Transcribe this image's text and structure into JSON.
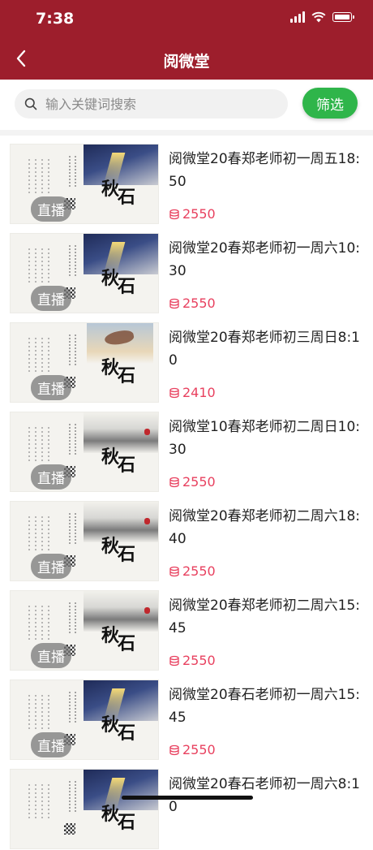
{
  "status_bar": {
    "time": "7:38"
  },
  "nav": {
    "title": "阅微堂"
  },
  "search": {
    "placeholder": "输入关键词搜索",
    "filter_label": "筛选"
  },
  "colors": {
    "brand": "#9d1e2c",
    "filter_green": "#2fb54a",
    "price_pink": "#e8415f"
  },
  "courses": [
    {
      "title": "阅微堂20春郑老师初一周五18:50",
      "price": "2550",
      "badge": "直播",
      "art": "night"
    },
    {
      "title": "阅微堂20春郑老师初一周六10:30",
      "price": "2550",
      "badge": "直播",
      "art": "night"
    },
    {
      "title": "阅微堂20春郑老师初三周日8:10",
      "price": "2410",
      "badge": "直播",
      "art": "crane"
    },
    {
      "title": "阅微堂10春郑老师初二周日10:30",
      "price": "2550",
      "badge": "直播",
      "art": "snow"
    },
    {
      "title": "阅微堂20春郑老师初二周六18:40",
      "price": "2550",
      "badge": "直播",
      "art": "snow"
    },
    {
      "title": "阅微堂20春郑老师初二周六15:45",
      "price": "2550",
      "badge": "直播",
      "art": "snow"
    },
    {
      "title": "阅微堂20春石老师初一周六15:45",
      "price": "2550",
      "badge": "直播",
      "art": "night"
    },
    {
      "title": "阅微堂20春石老师初一周六8:10",
      "price": "",
      "badge": "",
      "art": "night"
    }
  ],
  "thumbnail": {
    "calligraphy_1": "秋",
    "calligraphy_2": "石"
  }
}
